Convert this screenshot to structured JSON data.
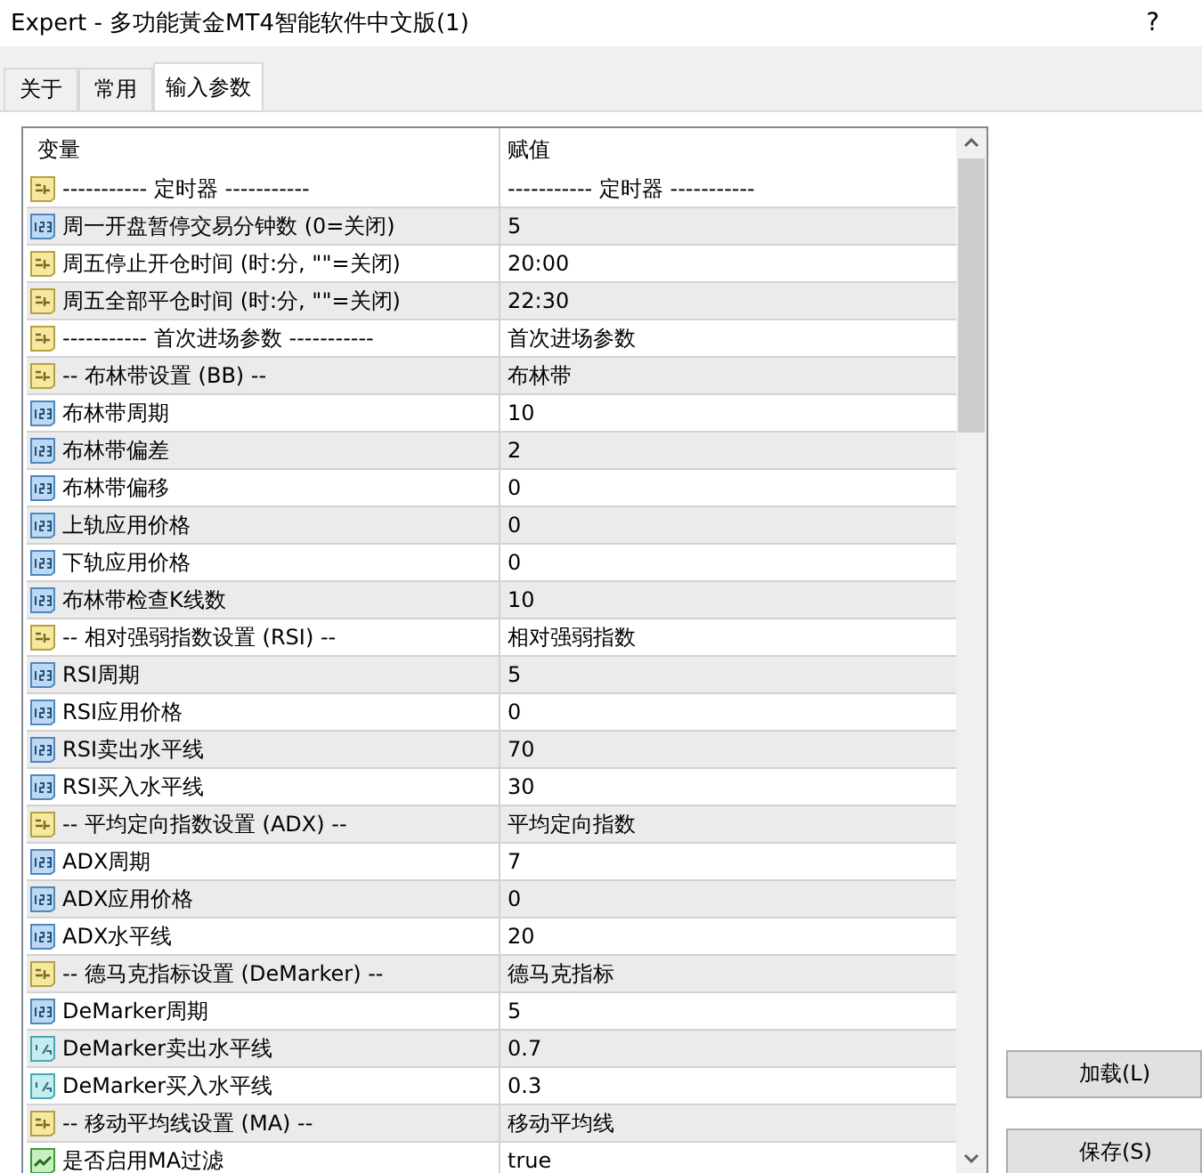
{
  "window": {
    "title": "Expert - 多功能黃金MT4智能软件中文版(1)",
    "help": "?"
  },
  "tabs": [
    {
      "label": "关于",
      "selected": false
    },
    {
      "label": "常用",
      "selected": false
    },
    {
      "label": "输入参数",
      "selected": true
    }
  ],
  "table": {
    "columns": [
      "变量",
      "赋值"
    ],
    "rows": [
      {
        "kind": "string",
        "name": "----------- 定时器 -----------",
        "value": "----------- 定时器 -----------"
      },
      {
        "kind": "int",
        "name": "周一开盘暂停交易分钟数 (0=关闭)",
        "value": "5"
      },
      {
        "kind": "string",
        "name": "周五停止开仓时间 (时:分, \"\"=关闭)",
        "value": "20:00"
      },
      {
        "kind": "string",
        "name": "周五全部平仓时间 (时:分, \"\"=关闭)",
        "value": "22:30"
      },
      {
        "kind": "string",
        "name": "----------- 首次进场参数 -----------",
        "value": "首次进场参数"
      },
      {
        "kind": "string",
        "name": "-- 布林带设置 (BB) --",
        "value": "布林带"
      },
      {
        "kind": "int",
        "name": "布林带周期",
        "value": "10"
      },
      {
        "kind": "int",
        "name": "布林带偏差",
        "value": "2"
      },
      {
        "kind": "int",
        "name": "布林带偏移",
        "value": "0"
      },
      {
        "kind": "int",
        "name": "上轨应用价格",
        "value": "0"
      },
      {
        "kind": "int",
        "name": "下轨应用价格",
        "value": "0"
      },
      {
        "kind": "int",
        "name": "布林带检查K线数",
        "value": "10"
      },
      {
        "kind": "string",
        "name": "-- 相对强弱指数设置 (RSI) --",
        "value": "相对强弱指数"
      },
      {
        "kind": "int",
        "name": "RSI周期",
        "value": "5"
      },
      {
        "kind": "int",
        "name": "RSI应用价格",
        "value": "0"
      },
      {
        "kind": "int",
        "name": "RSI卖出水平线",
        "value": "70"
      },
      {
        "kind": "int",
        "name": "RSI买入水平线",
        "value": "30"
      },
      {
        "kind": "string",
        "name": "-- 平均定向指数设置 (ADX) --",
        "value": "平均定向指数"
      },
      {
        "kind": "int",
        "name": "ADX周期",
        "value": "7"
      },
      {
        "kind": "int",
        "name": "ADX应用价格",
        "value": "0"
      },
      {
        "kind": "int",
        "name": "ADX水平线",
        "value": "20"
      },
      {
        "kind": "string",
        "name": "-- 德马克指标设置 (DeMarker) --",
        "value": "德马克指标"
      },
      {
        "kind": "int",
        "name": "DeMarker周期",
        "value": "5"
      },
      {
        "kind": "double",
        "name": "DeMarker卖出水平线",
        "value": "0.7"
      },
      {
        "kind": "double",
        "name": "DeMarker买入水平线",
        "value": "0.3"
      },
      {
        "kind": "string",
        "name": "-- 移动平均线设置 (MA) --",
        "value": "移动平均线"
      },
      {
        "kind": "bool",
        "name": "是否启用MA过滤",
        "value": "true"
      }
    ]
  },
  "buttons": [
    {
      "label": "加载(L)"
    },
    {
      "label": "保存(S)"
    }
  ]
}
